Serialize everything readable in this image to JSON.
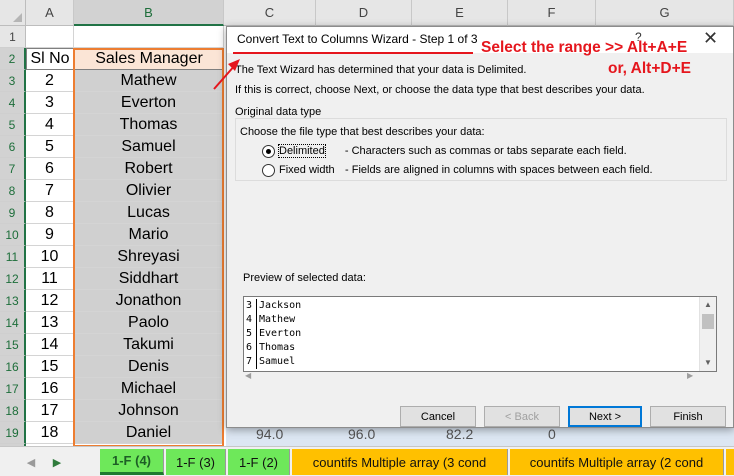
{
  "spreadsheet": {
    "col_headers": [
      "A",
      "B",
      "C",
      "D",
      "E",
      "F",
      "G"
    ],
    "row_headers": [
      "1",
      "2",
      "3",
      "4",
      "5",
      "6",
      "7",
      "8",
      "9",
      "10",
      "11",
      "12",
      "13",
      "14",
      "15",
      "16",
      "17",
      "18",
      "19",
      "20"
    ],
    "table_headers": [
      "Sl No",
      "Sales Manager"
    ],
    "filter_icon": "filter-dropdown-icon",
    "rows": [
      [
        "2",
        "Mathew"
      ],
      [
        "3",
        "Everton"
      ],
      [
        "4",
        "Thomas"
      ],
      [
        "5",
        "Samuel"
      ],
      [
        "6",
        "Robert"
      ],
      [
        "7",
        "Olivier"
      ],
      [
        "8",
        "Lucas"
      ],
      [
        "9",
        "Mario"
      ],
      [
        "10",
        "Shreyasi"
      ],
      [
        "11",
        "Siddhart"
      ],
      [
        "12",
        "Jonathon"
      ],
      [
        "13",
        "Paolo"
      ],
      [
        "14",
        "Takumi"
      ],
      [
        "15",
        "Denis"
      ],
      [
        "16",
        "Michael"
      ],
      [
        "17",
        "Johnson"
      ],
      [
        "18",
        "Daniel"
      ]
    ],
    "peek_values": [
      "94.0",
      "96.0",
      "82.2",
      "0"
    ],
    "selection_color": "#ed7d31",
    "header_fill": "#fbe5d6"
  },
  "sheet_tabs": [
    {
      "label": "1-F (4)",
      "active": true
    },
    {
      "label": "1-F (3)",
      "active": false
    },
    {
      "label": "1-F (2)",
      "active": false
    },
    {
      "label": "countifs Multiple array (3 cond",
      "active": false
    },
    {
      "label": "countifs Multiple array (2 cond",
      "active": false
    }
  ],
  "dialog": {
    "title": "Convert Text to Columns Wizard - Step 1 of 3",
    "help": "?",
    "close": "✕",
    "intro1": "The Text Wizard has determined that your data is Delimited.",
    "intro2": "If this is correct, choose Next, or choose the data type that best describes your data.",
    "group_label": "Original data type",
    "choose_label": "Choose the file type that best describes your data:",
    "options": [
      {
        "label": "Delimited",
        "desc": "- Characters such as commas or tabs separate each field.",
        "selected": true
      },
      {
        "label": "Fixed width",
        "desc": "- Fields are aligned in columns with spaces between each field.",
        "selected": false
      }
    ],
    "preview_label": "Preview of selected data:",
    "preview_lines": [
      {
        "num": "3",
        "text": "Jackson"
      },
      {
        "num": "4",
        "text": "Mathew"
      },
      {
        "num": "5",
        "text": "Everton"
      },
      {
        "num": "6",
        "text": "Thomas"
      },
      {
        "num": "7",
        "text": "Samuel"
      }
    ],
    "buttons": {
      "cancel": "Cancel",
      "back": "< Back",
      "next": "Next >",
      "finish": "Finish"
    }
  },
  "annotation": {
    "line1": "Select the range >> Alt+A+E",
    "line2": "or, Alt+D+E",
    "color": "#e5161d"
  }
}
